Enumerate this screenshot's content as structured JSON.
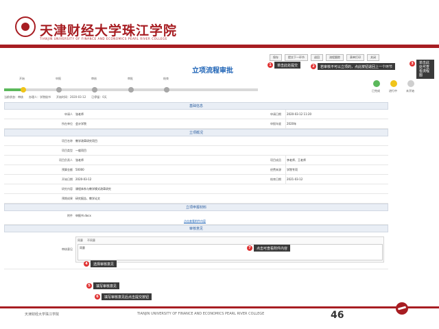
{
  "header": {
    "university_cn": "天津财经大学珠江学院",
    "university_en": "TIANJIN UNIVERSITY OF FINANCE AND ECONOMICS PEARL RIVER COLLEGE"
  },
  "toolbar": {
    "buttons": [
      "保存",
      "提交下一环节",
      "退回",
      "流程跟踪",
      "表单打印",
      "关闭"
    ]
  },
  "callouts": {
    "c1": {
      "num": "1",
      "text": "单击此处提交"
    },
    "c2": {
      "num": "2",
      "text": "若审核不可以立项的，点此按钮退回上一个环节"
    },
    "c3": {
      "num": "3",
      "text": "单击此处可查看流程图"
    },
    "c4": {
      "num": "4",
      "text": "选择审核意见"
    },
    "c5": {
      "num": "5",
      "text": "填写审核意见"
    },
    "c6": {
      "num": "6",
      "text": "填写审核意见后点击提交按钮"
    },
    "c7": {
      "num": "7",
      "text": "点击可查看附件内容"
    }
  },
  "page": {
    "title": "立项流程审批"
  },
  "progress": {
    "steps": [
      "开始",
      "申报",
      "审核",
      "审批",
      "结束"
    ],
    "status_text": "当前状态：审核　　办理人：学院秘书　　开始时间：2020-03-12　　已停留：0天",
    "done_fraction": 0.08
  },
  "legend": [
    {
      "label": "已完成",
      "color": "#5bb85b"
    },
    {
      "label": "进行中",
      "color": "#f0c419"
    },
    {
      "label": "未开始",
      "color": "#cfcfcf"
    }
  ],
  "form": {
    "sec_basic": "基础信息",
    "applicant_label": "申请人",
    "applicant": "张老师",
    "apply_date_label": "申请日期",
    "apply_date": "2020-03-12 11:20",
    "dept_label": "所在单位",
    "dept": "会计学院",
    "year_label": "申报年度",
    "year": "2020年",
    "sec_project": "立项概况",
    "proj_name_label": "项目名称",
    "proj_name": "教学改革研究项目",
    "proj_type_label": "项目类型",
    "proj_type": "一般项目",
    "leader_label": "项目负责人",
    "leader": "张老师",
    "members_label": "项目成员",
    "members": "李老师、王老师",
    "budget_label": "预算金额",
    "budget": "50000",
    "fund_label": "经费来源",
    "fund": "学院专项",
    "start_label": "开始日期",
    "start": "2020-03-12",
    "end_label": "结束日期",
    "end": "2021-03-12",
    "content_label": "研究内容",
    "content": "课程体系与教学模式改革研究",
    "goal_label": "预期成果",
    "goal": "研究报告、教学论文",
    "sec_attach": "立项申报材料",
    "attach_label": "附件",
    "attach": "申报书.docx",
    "attach_link": "点击查看附件内容",
    "sec_review": "审核意见",
    "opinion_label": "审核意见",
    "sig_tabs": [
      "同意",
      "不同意"
    ],
    "opinion_text": "同意"
  },
  "footer": {
    "left": "天津财经大学珠江学院",
    "mid": "TIANJIN UNIVERSITY OF FINANCE AND ECONOMICS PEARL RIVER COLLEGE",
    "page_num": "46"
  }
}
